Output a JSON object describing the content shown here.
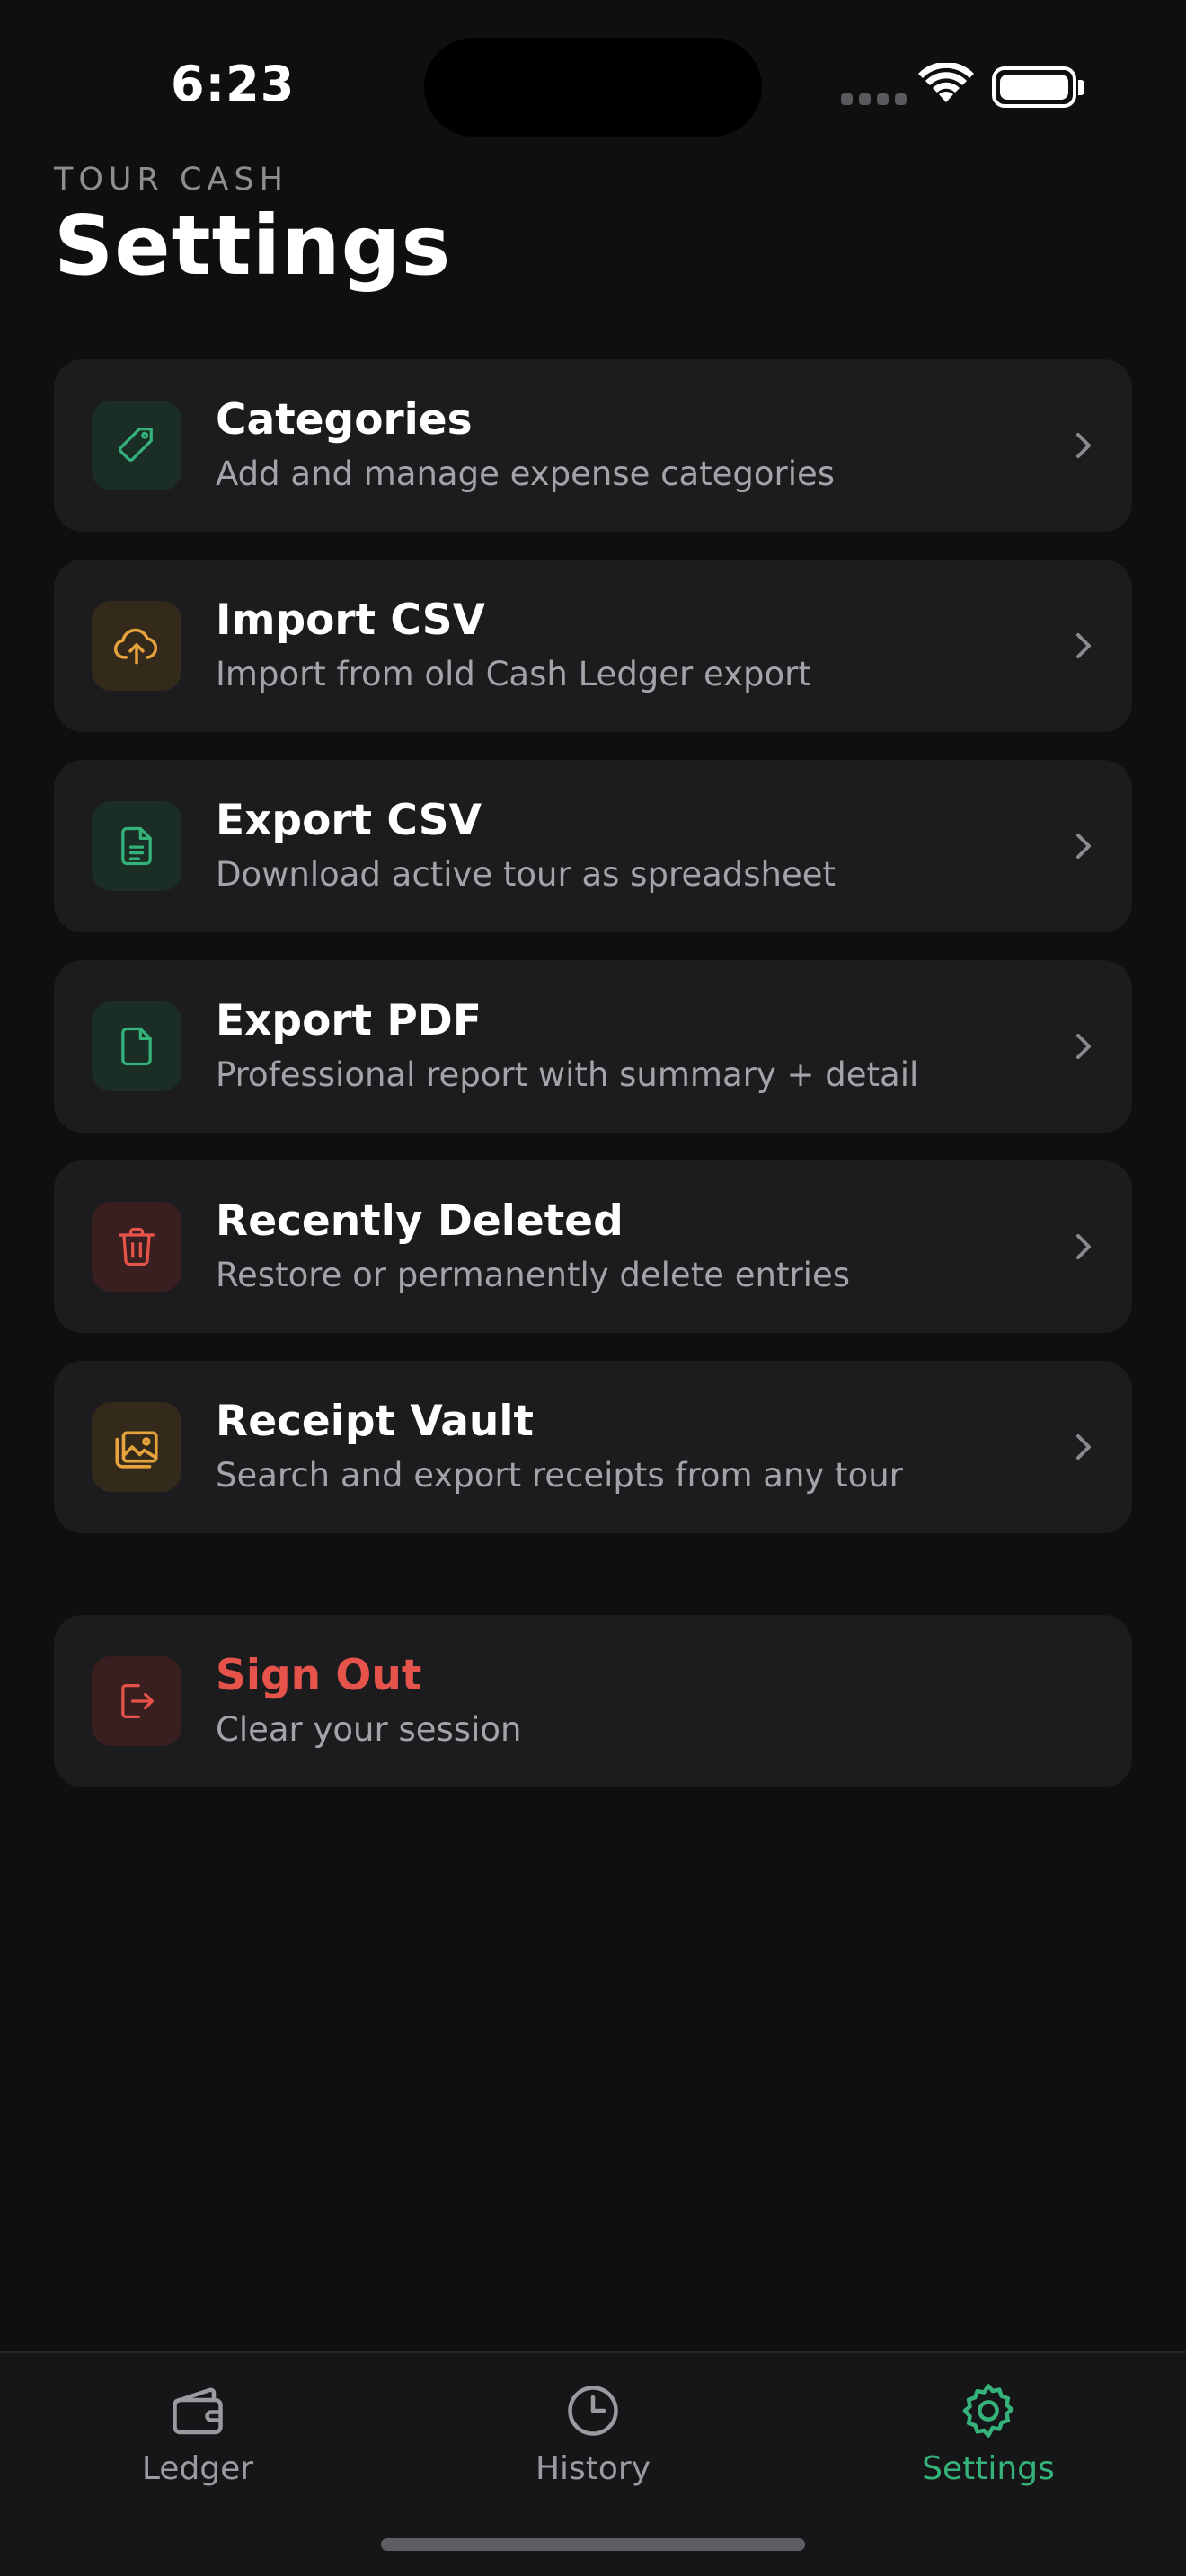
{
  "status_bar": {
    "time": "6:23"
  },
  "header": {
    "eyebrow": "TOUR CASH",
    "title": "Settings"
  },
  "items": [
    {
      "title": "Categories",
      "subtitle": "Add and manage expense categories",
      "icon": "tag-icon",
      "accent": "#34b27a"
    },
    {
      "title": "Import CSV",
      "subtitle": "Import from old Cash Ledger export",
      "icon": "cloud-upload-icon",
      "accent": "#e6a23c"
    },
    {
      "title": "Export CSV",
      "subtitle": "Download active tour as spreadsheet",
      "icon": "file-text-icon",
      "accent": "#34b27a"
    },
    {
      "title": "Export PDF",
      "subtitle": "Professional report with summary + detail",
      "icon": "file-icon",
      "accent": "#34b27a"
    },
    {
      "title": "Recently Deleted",
      "subtitle": "Restore or permanently delete entries",
      "icon": "trash-icon",
      "accent": "#e5534b"
    },
    {
      "title": "Receipt Vault",
      "subtitle": "Search and export receipts from any tour",
      "icon": "images-icon",
      "accent": "#e6a23c"
    }
  ],
  "sign_out": {
    "title": "Sign Out",
    "subtitle": "Clear your session",
    "icon": "log-out-icon",
    "accent": "#e5534b"
  },
  "tabs": [
    {
      "label": "Ledger",
      "icon": "wallet-icon",
      "active": false
    },
    {
      "label": "History",
      "icon": "clock-icon",
      "active": false
    },
    {
      "label": "Settings",
      "icon": "gear-icon",
      "active": true
    }
  ],
  "colors": {
    "active_tab": "#34b27a",
    "background": "#0f0f10",
    "card": "#1c1c1e"
  }
}
